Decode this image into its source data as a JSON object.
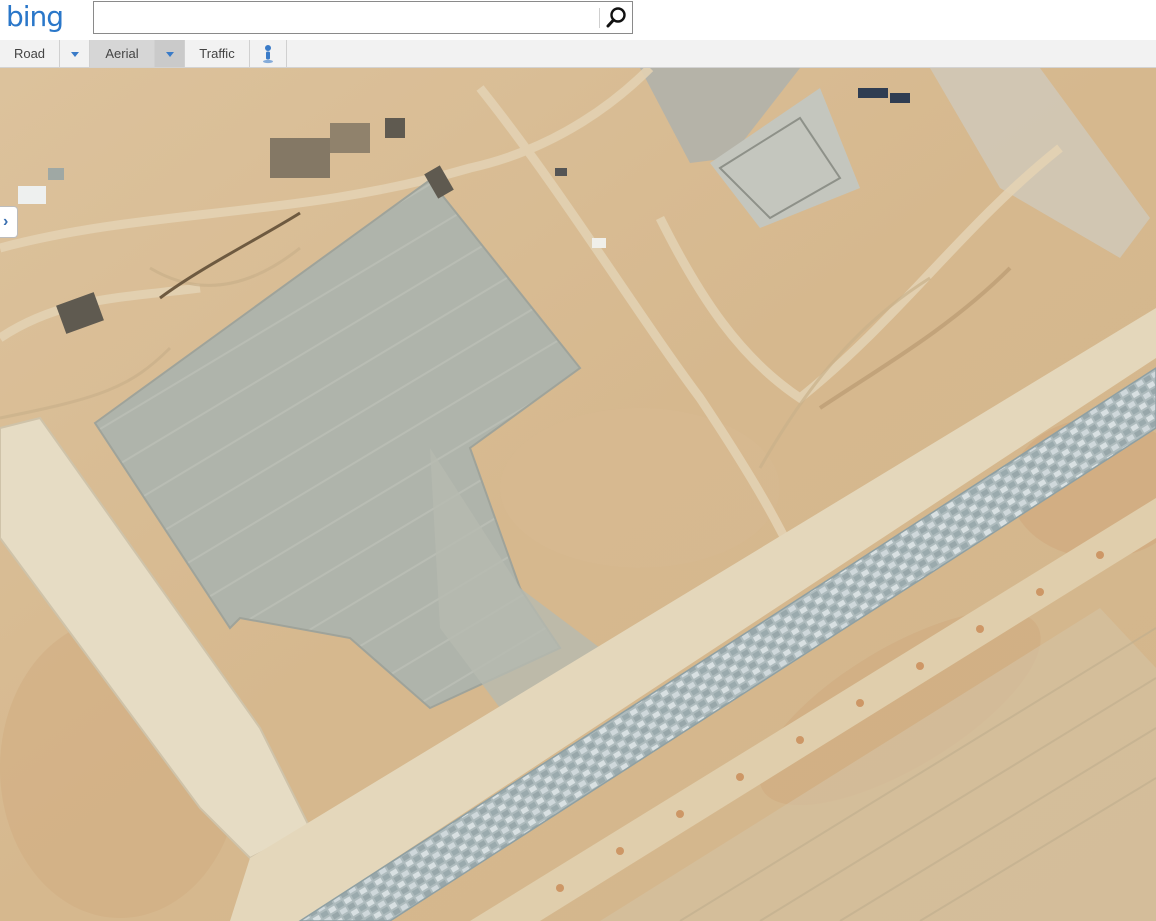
{
  "header": {
    "logo_text": "bing",
    "search": {
      "value": "",
      "placeholder": ""
    }
  },
  "toolbar": {
    "road_label": "Road",
    "aerial_label": "Aerial",
    "traffic_label": "Traffic",
    "selected": "Aerial"
  },
  "colors": {
    "logo": "#2a77c9",
    "desert_sand": "#d9bc92",
    "paved_slab": "#aeb3aa",
    "accent": "#3a7bc8"
  },
  "icons": {
    "search": "search-icon",
    "road_dropdown": "chevron-down-icon",
    "aerial_dropdown": "chevron-down-icon",
    "streetside": "person-icon",
    "side_panel": "chevron-right-icon"
  }
}
